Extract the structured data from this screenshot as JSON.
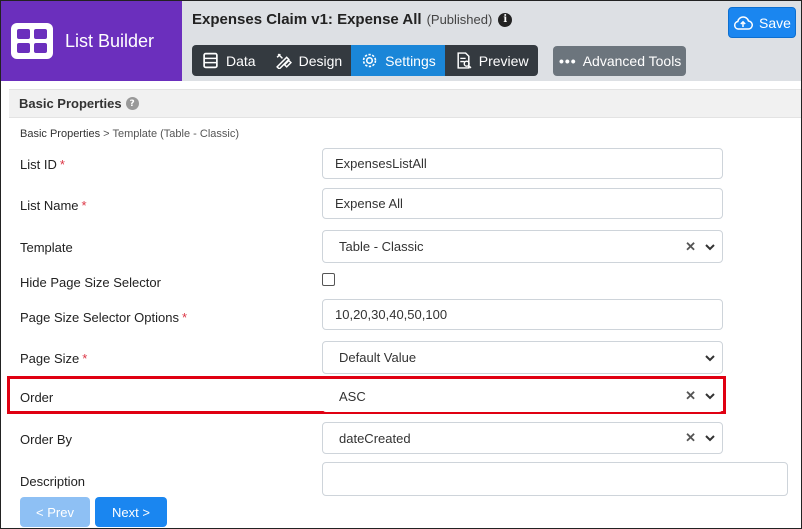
{
  "brand": {
    "label": "List Builder"
  },
  "header": {
    "title": "Expenses Claim v1: Expense All",
    "status": "(Published)",
    "info_glyph": "i",
    "save_label": "Save",
    "advanced_label": "Advanced Tools",
    "advanced_glyph": "•••"
  },
  "tabs": [
    {
      "label": "Data",
      "icon": "table-icon"
    },
    {
      "label": "Design",
      "icon": "design-tools-icon"
    },
    {
      "label": "Settings",
      "icon": "gear-icon",
      "active": true
    },
    {
      "label": "Preview",
      "icon": "preview-document-icon"
    }
  ],
  "section": {
    "title": "Basic Properties",
    "help_glyph": "?"
  },
  "breadcrumb": {
    "main": "Basic Properties",
    "separator": ">",
    "current": "Template (Table - Classic)"
  },
  "form": {
    "list_id": {
      "label": "List ID",
      "required": "*",
      "value": "ExpensesListAll"
    },
    "list_name": {
      "label": "List Name",
      "required": "*",
      "value": "Expense All"
    },
    "template": {
      "label": "Template",
      "value": "Table - Classic"
    },
    "hide_page_size": {
      "label": "Hide Page Size Selector",
      "checked": false
    },
    "page_size_options": {
      "label": "Page Size Selector Options",
      "required": "*",
      "value": "10,20,30,40,50,100"
    },
    "page_size": {
      "label": "Page Size",
      "required": "*",
      "value": "Default Value"
    },
    "order": {
      "label": "Order",
      "value": "ASC"
    },
    "order_by": {
      "label": "Order By",
      "value": "dateCreated"
    },
    "description": {
      "label": "Description",
      "value": ""
    }
  },
  "clear_glyph": "✕",
  "footer": {
    "prev_label": "< Prev",
    "next_label": "Next >"
  },
  "colors": {
    "brand": "#6b2fbd",
    "active_tab": "#1a86d8",
    "primary": "#1a86f0",
    "highlight": "#e00012",
    "required": "#dc3545"
  }
}
